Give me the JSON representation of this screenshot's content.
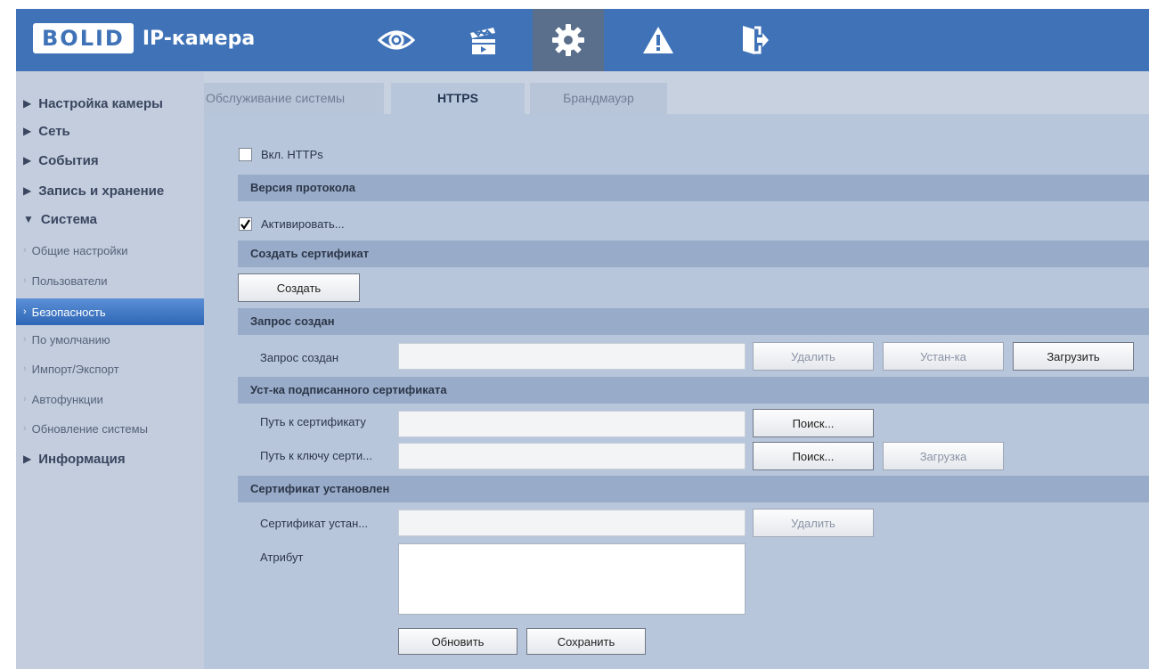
{
  "header": {
    "logo_brand": "BOLID",
    "logo_title": "IP-камера",
    "nav_icons": [
      "eye-icon",
      "clapperboard-icon",
      "gear-icon",
      "warning-icon",
      "logout-icon"
    ],
    "active_nav": "gear-icon"
  },
  "sidebar": {
    "camera_settings": "Настройка камеры",
    "network": "Сеть",
    "events": "События",
    "record_storage": "Запись и хранение",
    "system": "Система",
    "sub": {
      "general": "Общие настройки",
      "users": "Пользователи",
      "security": "Безопасность",
      "default": "По умолчанию",
      "import_export": "Импорт/Экспорт",
      "auto": "Автофункции",
      "update": "Обновление системы"
    },
    "info": "Информация"
  },
  "tabs": {
    "maintenance": "Обслуживание системы",
    "https": "HTTPS",
    "firewall": "Брандмауэр"
  },
  "form": {
    "enable_https": "Вкл. HTTPs",
    "enable_https_checked": false,
    "protocol_section": "Версия протокола",
    "activate": "Активировать...",
    "activate_checked": true,
    "create_cert_section": "Создать сертификат",
    "create_button": "Создать",
    "request_section": "Запрос создан",
    "request_label": "Запрос создан",
    "request_value": "",
    "delete_button": "Удалить",
    "install_button": "Устан-ка",
    "download_button": "Загрузить",
    "signed_section": "Уст-ка подписанного сертификата",
    "cert_path_label": "Путь к сертификату",
    "cert_path_value": "",
    "browse_button": "Поиск...",
    "key_path_label": "Путь к ключу серти...",
    "key_path_value": "",
    "browse_button2": "Поиск...",
    "upload_button": "Загрузка",
    "installed_section": "Сертификат установлен",
    "installed_label": "Сертификат устан...",
    "installed_value": "",
    "delete_button2": "Удалить",
    "attribute_label": "Атрибут",
    "attribute_value": "",
    "refresh_button": "Обновить",
    "save_button": "Сохранить"
  },
  "colors": {
    "header_blue": "#3f72b7",
    "content_bg": "#b8c6dc",
    "section_bar": "#98abc8",
    "sidebar_bg": "#c3cddd",
    "active_item": "#2f67b6"
  }
}
